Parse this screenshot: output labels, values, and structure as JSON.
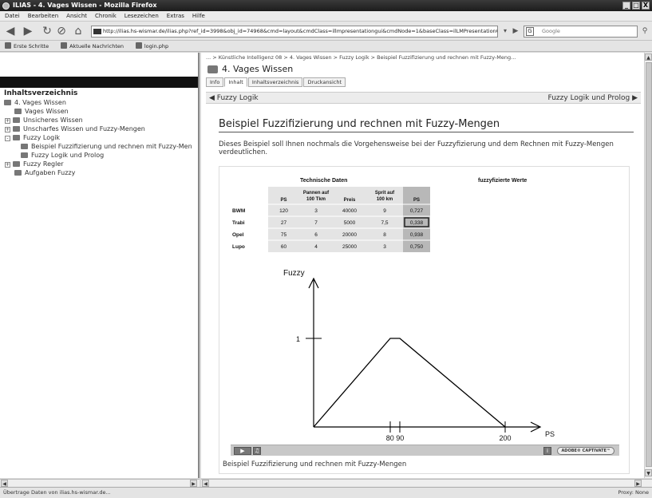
{
  "window": {
    "title": "ILIAS - 4. Vages Wissen - Mozilla Firefox",
    "min": "_",
    "max": "□",
    "close": "X"
  },
  "menu": [
    "Datei",
    "Bearbeiten",
    "Ansicht",
    "Chronik",
    "Lesezeichen",
    "Extras",
    "Hilfe"
  ],
  "nav": {
    "url": "http://ilias.hs-wismar.de/ilias.php?ref_id=3998&obj_id=74968&cmd=layout&cmdClass=illmpresentationgui&cmdNode=1&baseClass=ilLMPresentationGUI",
    "search_placeholder": "Google",
    "search_logo": "G"
  },
  "bookmarks": [
    "Erste Schritte",
    "Aktuelle Nachrichten",
    "login.php"
  ],
  "sidebar": {
    "title": "Inhaltsverzeichnis",
    "items": [
      {
        "label": "4. Vages Wissen",
        "pm": ""
      },
      {
        "label": "Vages Wissen",
        "pm": ""
      },
      {
        "label": "Unsicheres Wissen",
        "pm": "+"
      },
      {
        "label": "Unscharfes Wissen und Fuzzy-Mengen",
        "pm": "+"
      },
      {
        "label": "Fuzzy Logik",
        "pm": "-"
      },
      {
        "label": "Beispiel Fuzzifizierung und rechnen mit Fuzzy-Men",
        "pm": ""
      },
      {
        "label": "Fuzzy Logik und Prolog",
        "pm": ""
      },
      {
        "label": "Fuzzy Regler",
        "pm": "+"
      },
      {
        "label": "Aufgaben Fuzzy",
        "pm": ""
      }
    ]
  },
  "main": {
    "breadcrumb": "... > Künstliche Intelligenz 08 > 4. Vages Wissen > Fuzzy Logik > Beispiel Fuzzifizierung und rechnen mit Fuzzy-Meng...",
    "lm_title": "4. Vages Wissen",
    "tabs": [
      "Info",
      "Inhalt",
      "Inhaltsverzeichnis",
      "Druckansicht"
    ],
    "prev_label": "Fuzzy Logik",
    "next_label": "Fuzzy Logik und Prolog",
    "heading": "Beispiel Fuzzifizierung und rechnen mit Fuzzy-Mengen",
    "paragraph": "Dieses Beispiel soll Ihnen nochmals die Vorgehensweise bei der Fuzzyfizierung und dem Rechnen mit Fuzzy-Mengen verdeutlichen.",
    "caption": "Beispiel Fuzzifizierung und rechnen mit Fuzzy-Mengen",
    "player": {
      "adobe": "ADOBE® CAPTIVATE™"
    }
  },
  "figure": {
    "table_title": "Technische Daten",
    "fuzzy_title": "fuzzyfizierte Werte",
    "headers": [
      [
        "PS"
      ],
      [
        "Pannen auf",
        "100 Tkm"
      ],
      [
        "Preis"
      ],
      [
        "Sprit auf",
        "100 km"
      ],
      [
        "PS"
      ]
    ],
    "rows": [
      [
        "BWM",
        "120",
        "3",
        "40000",
        "9",
        "0,727"
      ],
      [
        "Trabi",
        "27",
        "7",
        "5000",
        "7,5",
        "0,338"
      ],
      [
        "Opel",
        "75",
        "6",
        "20000",
        "8",
        "0,938"
      ],
      [
        "Lupo",
        "60",
        "4",
        "25000",
        "3",
        "0,750"
      ]
    ]
  },
  "chart_data": {
    "type": "line",
    "ylabel": "Fuzzy",
    "xlabel": "PS",
    "x": [
      0,
      80,
      90,
      200
    ],
    "y": [
      0,
      1,
      1,
      0
    ],
    "x_tick_labels": [
      "80",
      "90",
      "200"
    ],
    "y_tick_labels": [
      "1"
    ]
  },
  "status": {
    "left": "Übertrage Daten von ilias.hs-wismar.de...",
    "right": "Proxy: None"
  }
}
